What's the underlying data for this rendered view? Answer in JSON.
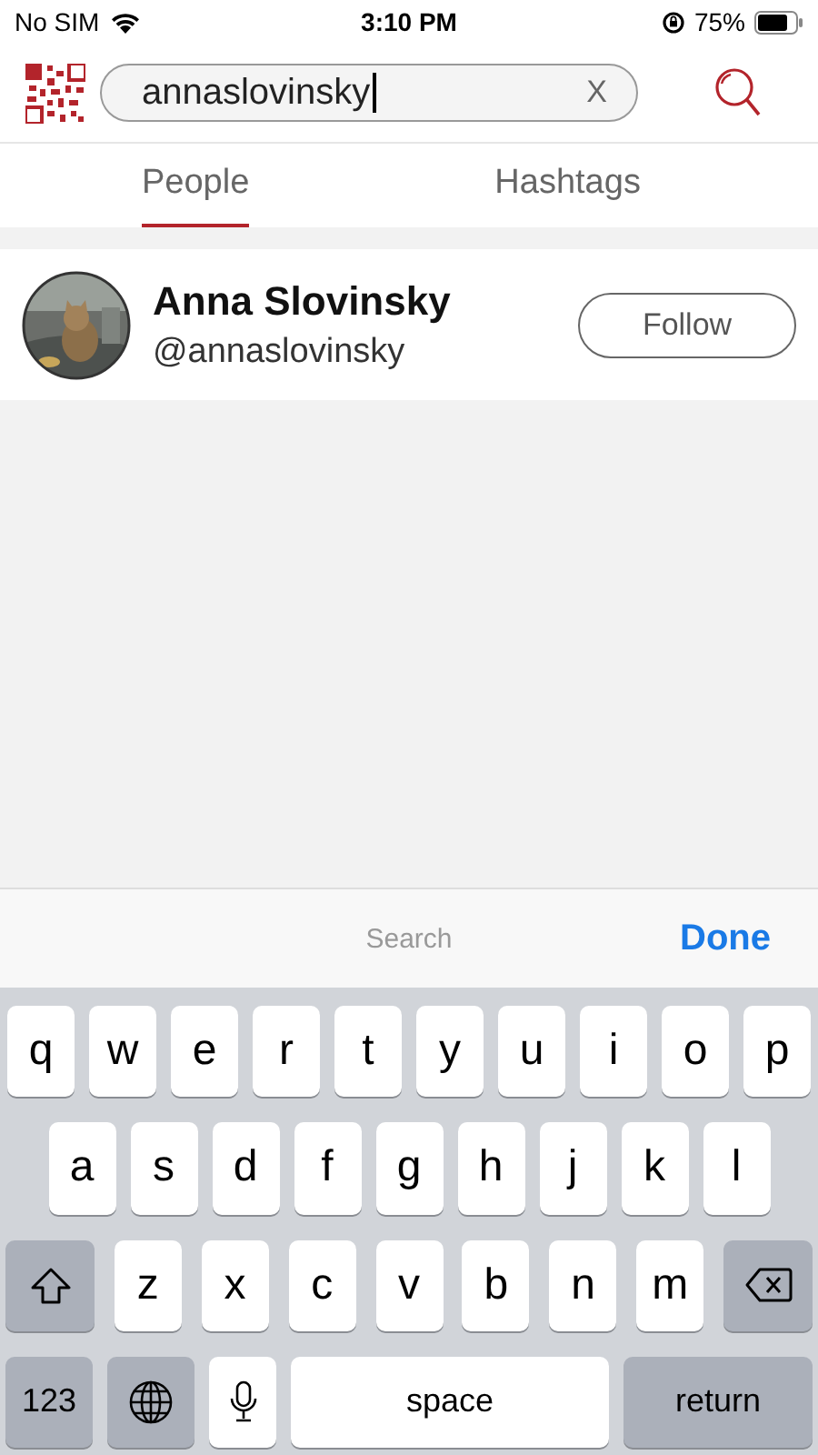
{
  "status_bar": {
    "carrier": "No SIM",
    "time": "3:10 PM",
    "battery": "75%"
  },
  "search": {
    "value": "annaslovinsky",
    "clear": "X"
  },
  "tabs": [
    {
      "label": "People",
      "selected": true
    },
    {
      "label": "Hashtags",
      "selected": false
    }
  ],
  "results": [
    {
      "name": "Anna Slovinsky",
      "handle": "@annaslovinsky",
      "button": "Follow"
    }
  ],
  "keyboard": {
    "accessory_title": "Search",
    "done": "Done",
    "rows": [
      {
        "keys": [
          {
            "kind": "letter",
            "label": "q"
          },
          {
            "kind": "letter",
            "label": "w"
          },
          {
            "kind": "letter",
            "label": "e"
          },
          {
            "kind": "letter",
            "label": "r"
          },
          {
            "kind": "letter",
            "label": "t"
          },
          {
            "kind": "letter",
            "label": "y"
          },
          {
            "kind": "letter",
            "label": "u"
          },
          {
            "kind": "letter",
            "label": "i"
          },
          {
            "kind": "letter",
            "label": "o"
          },
          {
            "kind": "letter",
            "label": "p"
          }
        ]
      },
      {
        "keys": [
          {
            "kind": "letter",
            "label": "a"
          },
          {
            "kind": "letter",
            "label": "s"
          },
          {
            "kind": "letter",
            "label": "d"
          },
          {
            "kind": "letter",
            "label": "f"
          },
          {
            "kind": "letter",
            "label": "g"
          },
          {
            "kind": "letter",
            "label": "h"
          },
          {
            "kind": "letter",
            "label": "j"
          },
          {
            "kind": "letter",
            "label": "k"
          },
          {
            "kind": "letter",
            "label": "l"
          }
        ]
      },
      {
        "keys": [
          {
            "kind": "shift"
          },
          {
            "kind": "letter",
            "label": "z"
          },
          {
            "kind": "letter",
            "label": "x"
          },
          {
            "kind": "letter",
            "label": "c"
          },
          {
            "kind": "letter",
            "label": "v"
          },
          {
            "kind": "letter",
            "label": "b"
          },
          {
            "kind": "letter",
            "label": "n"
          },
          {
            "kind": "letter",
            "label": "m"
          },
          {
            "kind": "delete"
          }
        ]
      },
      {
        "keys": [
          {
            "kind": "numbers",
            "label": "123"
          },
          {
            "kind": "globe"
          },
          {
            "kind": "mic"
          },
          {
            "kind": "space",
            "label": "space"
          },
          {
            "kind": "return",
            "label": "return"
          }
        ]
      }
    ]
  }
}
